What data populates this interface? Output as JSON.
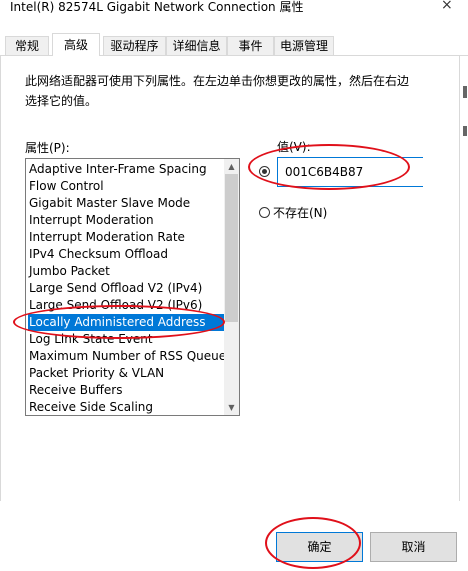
{
  "window": {
    "title": "Intel(R) 82574L Gigabit Network Connection 属性",
    "close_glyph": "×"
  },
  "tabs": [
    "常规",
    "高级",
    "驱动程序",
    "详细信息",
    "事件",
    "电源管理"
  ],
  "active_tab": "高级",
  "description": "此网络适配器可使用下列属性。在左边单击你想更改的属性，然后在右边选择它的值。",
  "property_label": "属性(P):",
  "value_label": "值(V):",
  "properties": [
    "Adaptive Inter-Frame Spacing",
    "Flow Control",
    "Gigabit Master Slave Mode",
    "Interrupt Moderation",
    "Interrupt Moderation Rate",
    "IPv4 Checksum Offload",
    "Jumbo Packet",
    "Large Send Offload V2 (IPv4)",
    "Large Send Offload V2 (IPv6)",
    "Locally Administered Address",
    "Log Link State Event",
    "Maximum Number of RSS Queue",
    "Packet Priority & VLAN",
    "Receive Buffers",
    "Receive Side Scaling"
  ],
  "selected_property": "Locally Administered Address",
  "value_field": "001C6B4B87",
  "not_present_label": "不存在(N)",
  "buttons": {
    "ok": "确定",
    "cancel": "取消"
  },
  "colors": {
    "selection": "#0078d7",
    "annotation": "#e0101a"
  },
  "icons": {
    "scroll_up": "▲",
    "scroll_down": "▼"
  }
}
